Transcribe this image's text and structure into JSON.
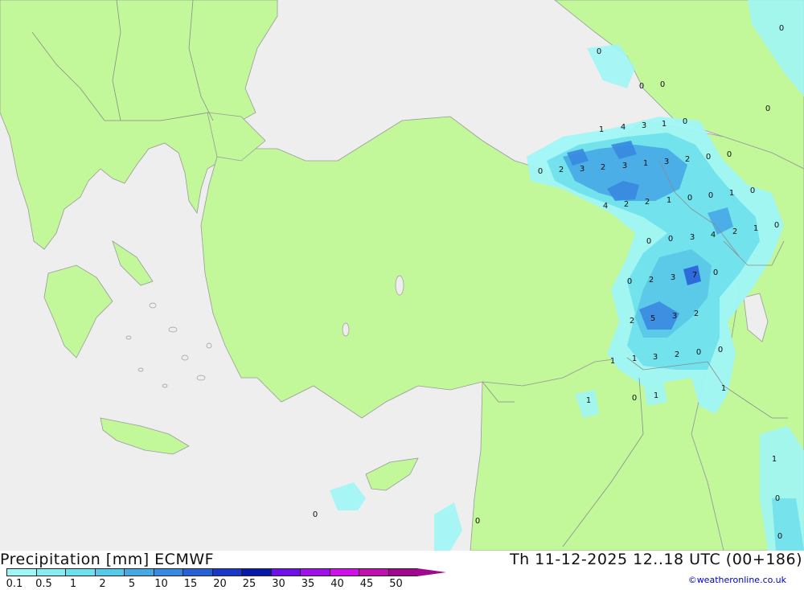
{
  "title": "Precipitation [mm] ECMWF",
  "valid_time": "Th 11-12-2025 12..18 UTC (00+186)",
  "credit": "©weatheronline.co.uk",
  "legend": [
    {
      "label": "0.1",
      "color": "#a0f5f5"
    },
    {
      "label": "0.5",
      "color": "#88ecf0"
    },
    {
      "label": "1",
      "color": "#70e0ec"
    },
    {
      "label": "2",
      "color": "#58c8e8"
    },
    {
      "label": "5",
      "color": "#48a8e4"
    },
    {
      "label": "10",
      "color": "#3888e0"
    },
    {
      "label": "15",
      "color": "#2860d8"
    },
    {
      "label": "20",
      "color": "#1838c8"
    },
    {
      "label": "25",
      "color": "#0818a8"
    },
    {
      "label": "30",
      "color": "#7010e8"
    },
    {
      "label": "35",
      "color": "#a010e8"
    },
    {
      "label": "40",
      "color": "#d010e8"
    },
    {
      "label": "45",
      "color": "#c010b0"
    },
    {
      "label": "50",
      "color": "#a00890"
    }
  ],
  "colors": {
    "sea": "#eeeeee",
    "land": "#c2f79a",
    "border": "#8c8c8c"
  },
  "station_values": [
    "0",
    "0",
    "0",
    "0",
    "1",
    "4",
    "3",
    "1",
    "0",
    "0",
    "0",
    "2",
    "3",
    "2",
    "3",
    "1",
    "3",
    "2",
    "0",
    "0",
    "4",
    "2",
    "2",
    "1",
    "0",
    "0",
    "1",
    "0",
    "0",
    "0",
    "3",
    "4",
    "2",
    "1",
    "0",
    "0",
    "2",
    "3",
    "7",
    "0",
    "2",
    "5",
    "3",
    "2",
    "1",
    "1",
    "3",
    "2",
    "0",
    "0",
    "1",
    "1",
    "0",
    "1",
    "1",
    "0",
    "0",
    "0",
    "0"
  ]
}
